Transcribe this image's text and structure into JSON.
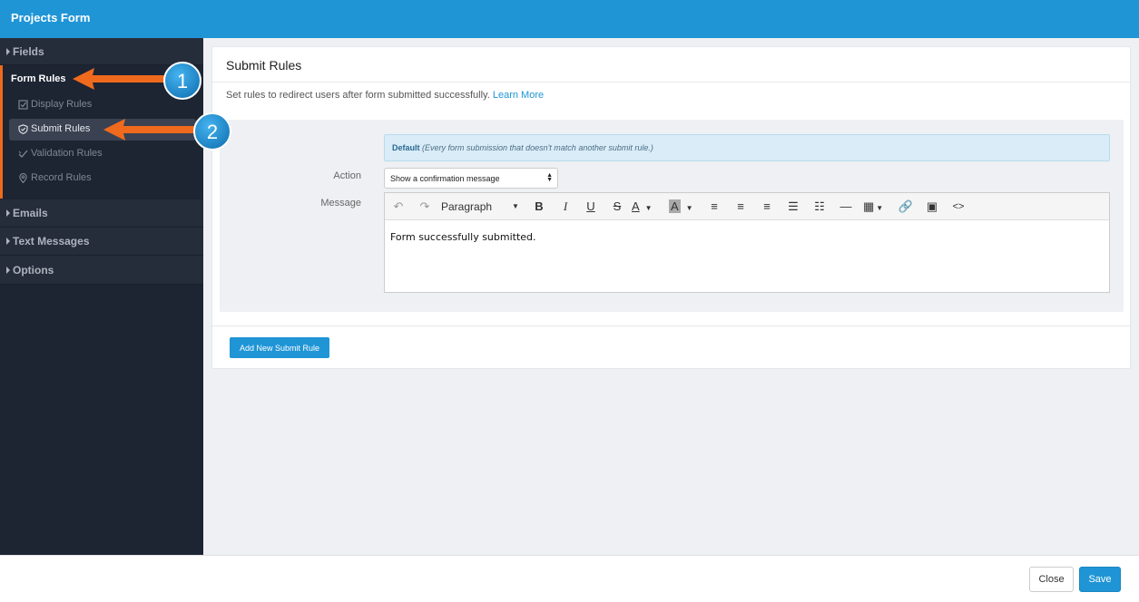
{
  "app": {
    "title": "Projects Form"
  },
  "sidebar": {
    "fields_label": "Fields",
    "form_rules_label": "Form Rules",
    "form_rules_items": [
      {
        "label": "Display Rules",
        "icon": "checkbox-icon"
      },
      {
        "label": "Submit Rules",
        "icon": "shield-icon"
      },
      {
        "label": "Validation Rules",
        "icon": "check-icon"
      },
      {
        "label": "Record Rules",
        "icon": "pin-icon"
      }
    ],
    "emails_label": "Emails",
    "text_messages_label": "Text Messages",
    "options_label": "Options"
  },
  "main": {
    "title": "Submit Rules",
    "description": "Set rules to redirect users after form submitted successfully.",
    "learn_more": "Learn More",
    "rule": {
      "default_title": "Default",
      "default_note": "(Every form submission that doesn't match another submit rule.)",
      "action_label": "Action",
      "action_value": "Show a confirmation message",
      "message_label": "Message",
      "paragraph_label": "Paragraph",
      "message_content": "Form successfully submitted."
    },
    "add_button": "Add New Submit Rule"
  },
  "footer": {
    "close_label": "Close",
    "save_label": "Save"
  },
  "annotations": {
    "callout_1": "1",
    "callout_2": "2"
  },
  "colors": {
    "accent": "#1f95d6",
    "callout_arrow": "#f06a1d",
    "sidebar_bg": "#1d2432"
  }
}
